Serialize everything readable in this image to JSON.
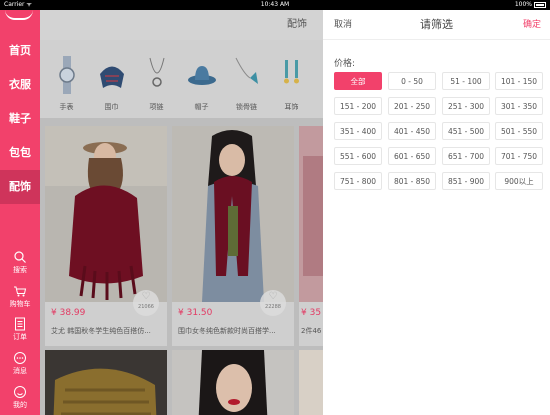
{
  "status_bar": {
    "carrier": "Carrier ᯤ",
    "time": "10:43 AM",
    "battery": "100%"
  },
  "sidebar": {
    "categories": [
      {
        "label": "首页"
      },
      {
        "label": "衣服"
      },
      {
        "label": "鞋子"
      },
      {
        "label": "包包"
      },
      {
        "label": "配饰",
        "active": true
      }
    ],
    "tools": [
      {
        "label": "搜索",
        "icon": "search-icon"
      },
      {
        "label": "购物车",
        "icon": "cart-icon"
      },
      {
        "label": "订单",
        "icon": "order-icon"
      },
      {
        "label": "消息",
        "icon": "message-icon"
      },
      {
        "label": "我的",
        "icon": "profile-icon"
      }
    ]
  },
  "main": {
    "title": "配饰",
    "category_strip": [
      {
        "label": "手表",
        "icon": "watch-icon"
      },
      {
        "label": "围巾",
        "icon": "scarf-icon"
      },
      {
        "label": "项链",
        "icon": "necklace-icon"
      },
      {
        "label": "帽子",
        "icon": "hat-icon"
      },
      {
        "label": "锁骨链",
        "icon": "pendant-icon"
      },
      {
        "label": "耳饰",
        "icon": "earring-icon"
      }
    ],
    "products": [
      {
        "price": "¥ 38.99",
        "likes": "21066",
        "desc": "艾尤 韩国秋冬学生纯色百搭仿..."
      },
      {
        "price": "¥ 31.50",
        "likes": "22288",
        "desc": "围巾女冬纯色新款时尚百搭学..."
      },
      {
        "price": "¥ 35",
        "likes": "",
        "desc": "2件46"
      }
    ]
  },
  "filter": {
    "cancel": "取消",
    "title": "请筛选",
    "confirm": "确定",
    "price_label": "价格:",
    "options": [
      "全部",
      "0 - 50",
      "51 - 100",
      "101 - 150",
      "151 - 200",
      "201 - 250",
      "251 - 300",
      "301 - 350",
      "351 - 400",
      "401 - 450",
      "451 - 500",
      "501 - 550",
      "551 - 600",
      "601 - 650",
      "651 - 700",
      "701 - 750",
      "751 - 800",
      "801 - 850",
      "851 - 900",
      "900以上"
    ],
    "selected_index": 0,
    "accent_color": "#f2416b"
  }
}
